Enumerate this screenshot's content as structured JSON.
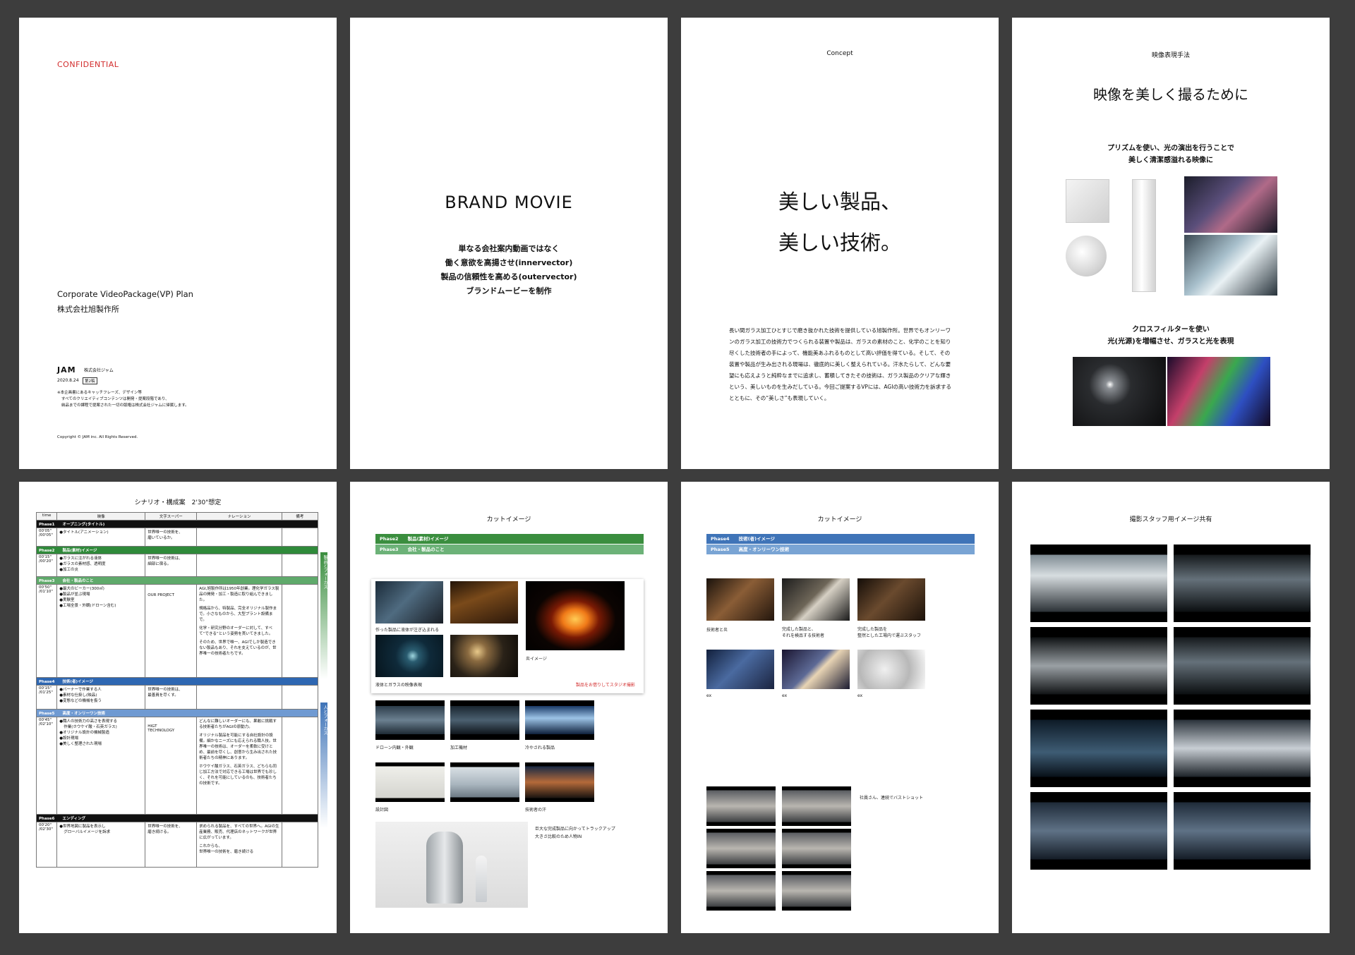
{
  "page1": {
    "confidential": "CONFIDENTIAL",
    "plan_title": "Corporate VideoPackage(VP) Plan",
    "client": "株式会社旭製作所",
    "logo_text": "JAM",
    "company": "株式会社ジャム",
    "date": "2020.8.24",
    "edition": "第2稿",
    "notes": [
      "※本企画書にあるキャッチフレーズ、デザイン等",
      "すべてのクリエイティブコンテンツは開発・提案段階であり、",
      "納品までの課程で提案された一切の版権は株式会社ジャムに帰属します。"
    ],
    "copyright": "Copyright © JAM inc. All Rights Reserved."
  },
  "page2": {
    "title": "BRAND MOVIE",
    "lines": [
      "単なる会社案内動画ではなく",
      "働く意欲を高揚させ(innervector)",
      "製品の信頼性を高める(outervector)",
      "ブランドムービーを制作"
    ]
  },
  "page3": {
    "label": "Concept",
    "headline1": "美しい製品、",
    "headline2": "美しい技術。",
    "body": "長い間ガラス加工ひとすじで磨き抜かれた技術を提供している旭製作所。世界でもオンリーワンのガラス加工の技術力でつくられる装置や製品は、ガラスの素材のこと、化学のことを知り尽くした技術者の手によって、機能美あふれるものとして高い評価を得ている。そして、その装置や製品が生み出される現場は、徹底的に美しく整えられている。汗水たらして、どんな要望にも応えようと純粋なまでに追求し、蓄積してきたその技術は、ガラス製品のクリアな輝きという、美しいものを生みだしている。今回ご提案するVPには、AGIの高い技術力を訴求するとともに、その“美しさ”も表現していく。"
  },
  "page4": {
    "label": "映像表現手法",
    "title": "映像を美しく撮るために",
    "sub1": [
      "プリズムを使い、光の演出を行うことで",
      "美しく清潔感溢れる映像に"
    ],
    "sub2": [
      "クロスフィルターを使い",
      "光(光源)を増幅させ、ガラスと光を表現"
    ]
  },
  "page5": {
    "title": "シナリオ・構成案　2'30\"想定",
    "headers": [
      "time",
      "映像",
      "文字スーパー",
      "ナレーション",
      "備考"
    ],
    "side_label_top": "製品とフォーカス",
    "side_label_bottom": "人とフォーカス",
    "phases": [
      {
        "label": "Phase1",
        "name": "オープニング(タイトル)",
        "style": "black",
        "time": [
          "00'05\"",
          "/00'05\""
        ],
        "video": [
          "●タイトル(アニメーション)"
        ],
        "super": [
          "世界唯一の技術を、",
          "磨いているか。"
        ],
        "narr": []
      },
      {
        "label": "Phase2",
        "name": "製品(素材)イメージ",
        "style": "green",
        "time": [
          "00'15\"",
          "/00'20\""
        ],
        "video": [
          "●ガラスに注がれる液体",
          "●ガラスの素材感、透明度",
          "●加工の炎"
        ],
        "super": [
          "世界唯一の技術は、",
          "細部に宿る。"
        ],
        "narr": []
      },
      {
        "label": "Phase3",
        "name": "会社・製品のこと",
        "style": "lgreen",
        "time": [
          "00'50\"",
          "/01'10\""
        ],
        "video": [
          "●最大のビーカー(300㎡)",
          "●製品が並ぶ現場",
          "●実験室",
          "●工場全景・外観(ドローン含む)"
        ],
        "super": [
          "OUR PROJECT"
        ],
        "narr": [
          "AGI,旭製作所は1950年創業。理化学ガラス製品の開発・加工・製造に取り組んできました。",
          "規格品から、特製品、完全オリジナル製作まで。小さなものから、大型プラント設備まで。",
          "化学・研究分野のオーダーに対して、すべて“できる”という姿勢を貫いてきました。",
          "そのため、世界で唯一、AGIでしか製造できない製品もあり、それを支えているのが、世界唯一の技術者たちです。"
        ]
      },
      {
        "label": "Phase4",
        "name": "技術(者)イメージ",
        "style": "blue",
        "time": [
          "00'15\"",
          "/01'25\""
        ],
        "video": [
          "●バーナーで作業する人",
          "●素材な仕掛し(映品)",
          "●変態などの機械を扱う"
        ],
        "super": [
          "世界唯一の技術は、",
          "最善員を尽くす。"
        ],
        "narr": []
      },
      {
        "label": "Phase5",
        "name": "高度・オンリーワン技術",
        "style": "lblue",
        "time": [
          "00'45\"",
          "/02'10\""
        ],
        "video": [
          "●職人の技術力の高さを表現する",
          "作業(ホウケイ酸・石英ガラス)",
          "●オリジナル設計の機械製造",
          "●設計現場",
          "●美しく整理された現場"
        ],
        "super": [
          "HIGT",
          "TECHNOLOGY"
        ],
        "narr": [
          "どんなに難しいオーダーにも、果敢に挑戦する技術者たちがAGIの原動力。",
          "オリジナル製品を可能にする自社設計の設備。細かなニーズにも応えられる職人技。世界唯一の技術は、オーダーを柔軟に受けとめ、最前を尽くし、創意から生み出された技術者たちの精神にあります。",
          "ホウケイ酸ガラス、石英ガラス、どちらも同じ加工方法で対応できる工場は世界でも珍しく、それを可能にしているのも、技術者たちの技術です。"
        ]
      },
      {
        "label": "Phase6",
        "name": "エンディング",
        "style": "black",
        "time": [
          "00'20\"",
          "/02'30\""
        ],
        "video": [
          "●世界地図に製品を表示し",
          "グローバルイメージを訴求"
        ],
        "super": [
          "世界唯一の技術を、",
          "磨き続ける。"
        ],
        "narr": [
          "求められる製品を、すべての世界へ。AGIの生産業務、販売、代理店のネットワークが世界に広がっています。",
          "これからも、",
          "世界唯一の技術を、磨き続ける"
        ]
      }
    ]
  },
  "page6": {
    "title": "カットイメージ",
    "band1": "Phase2　　製品(素材)イメージ",
    "band2": "Phase3　　会社・製品のこと",
    "cap_pour": "作った製品に液体が注ぎ込まれる",
    "cap_fire": "炎イメージ",
    "cap_liquid": "液体とガラスの映像表現",
    "studio_note": "製品をお借りしてスタジオ撮影",
    "cap_drone": "ドローン内観・外観",
    "cap_material": "加工機材",
    "cap_cooled": "冷やされる製品",
    "cap_blueprint": "設計図",
    "cap_sweat": "技術者の汗",
    "note_track": [
      "巨大な完成製品に向かってトラックアップ",
      "大きさ比較のため人物IN"
    ]
  },
  "page7": {
    "title": "カットイメージ",
    "band1": "Phase4　　技術(者)イメージ",
    "band2": "Phase5　　高度・オンリーワン技術",
    "cap1": "技術者と炎",
    "cap2": [
      "完成した製品と、",
      "それを検品する技術者"
    ],
    "cap3": [
      "完成した製品を",
      "整然とした工場内で運ぶスタッフ"
    ],
    "cap_ex1": "ex",
    "cap_ex2": "ex",
    "cap_ex3": "ex",
    "note_staff": "社員さん、連続でバストショット"
  },
  "page8": {
    "title": "撮影スタッフ用イメージ共有"
  }
}
